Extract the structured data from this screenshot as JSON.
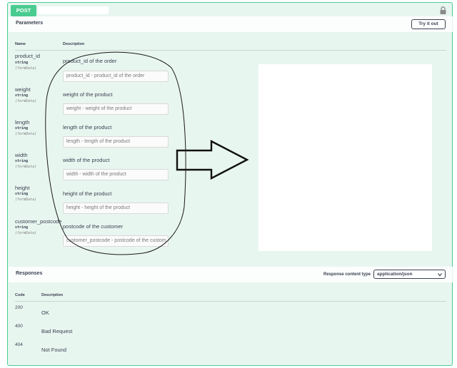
{
  "operation": {
    "method": "POST",
    "path": "",
    "lock_icon": "lock-icon"
  },
  "parameters": {
    "title": "Parameters",
    "try_button": "Try it out",
    "columns": {
      "name": "Name",
      "description": "Description"
    },
    "items": [
      {
        "name": "product_id",
        "type": "string",
        "in": "(formData)",
        "description": "product_id of the order",
        "placeholder": "product_id - product_id of the order"
      },
      {
        "name": "weight",
        "type": "string",
        "in": "(formData)",
        "description": "weight of the product",
        "placeholder": "weight - weight of the product"
      },
      {
        "name": "length",
        "type": "string",
        "in": "(formData)",
        "description": "length of the product",
        "placeholder": "length - length of the product"
      },
      {
        "name": "width",
        "type": "string",
        "in": "(formData)",
        "description": "width of the product",
        "placeholder": "width - width of the product"
      },
      {
        "name": "height",
        "type": "string",
        "in": "(formData)",
        "description": "height of the product",
        "placeholder": "height - height of the product"
      },
      {
        "name": "customer_postcode",
        "type": "string",
        "in": "(formData)",
        "description": "postcode of the customer",
        "placeholder": "customer_postcode - postcode of the custom"
      }
    ]
  },
  "responses": {
    "title": "Responses",
    "content_type_label": "Response content type",
    "content_type_value": "application/json",
    "columns": {
      "code": "Code",
      "description": "Description"
    },
    "items": [
      {
        "code": "200",
        "description": "OK"
      },
      {
        "code": "400",
        "description": "Bad Request"
      },
      {
        "code": "404",
        "description": "Not Found"
      }
    ]
  },
  "colors": {
    "post": "#49cc90",
    "background": "#e8f6f0",
    "text": "#3b4151"
  }
}
